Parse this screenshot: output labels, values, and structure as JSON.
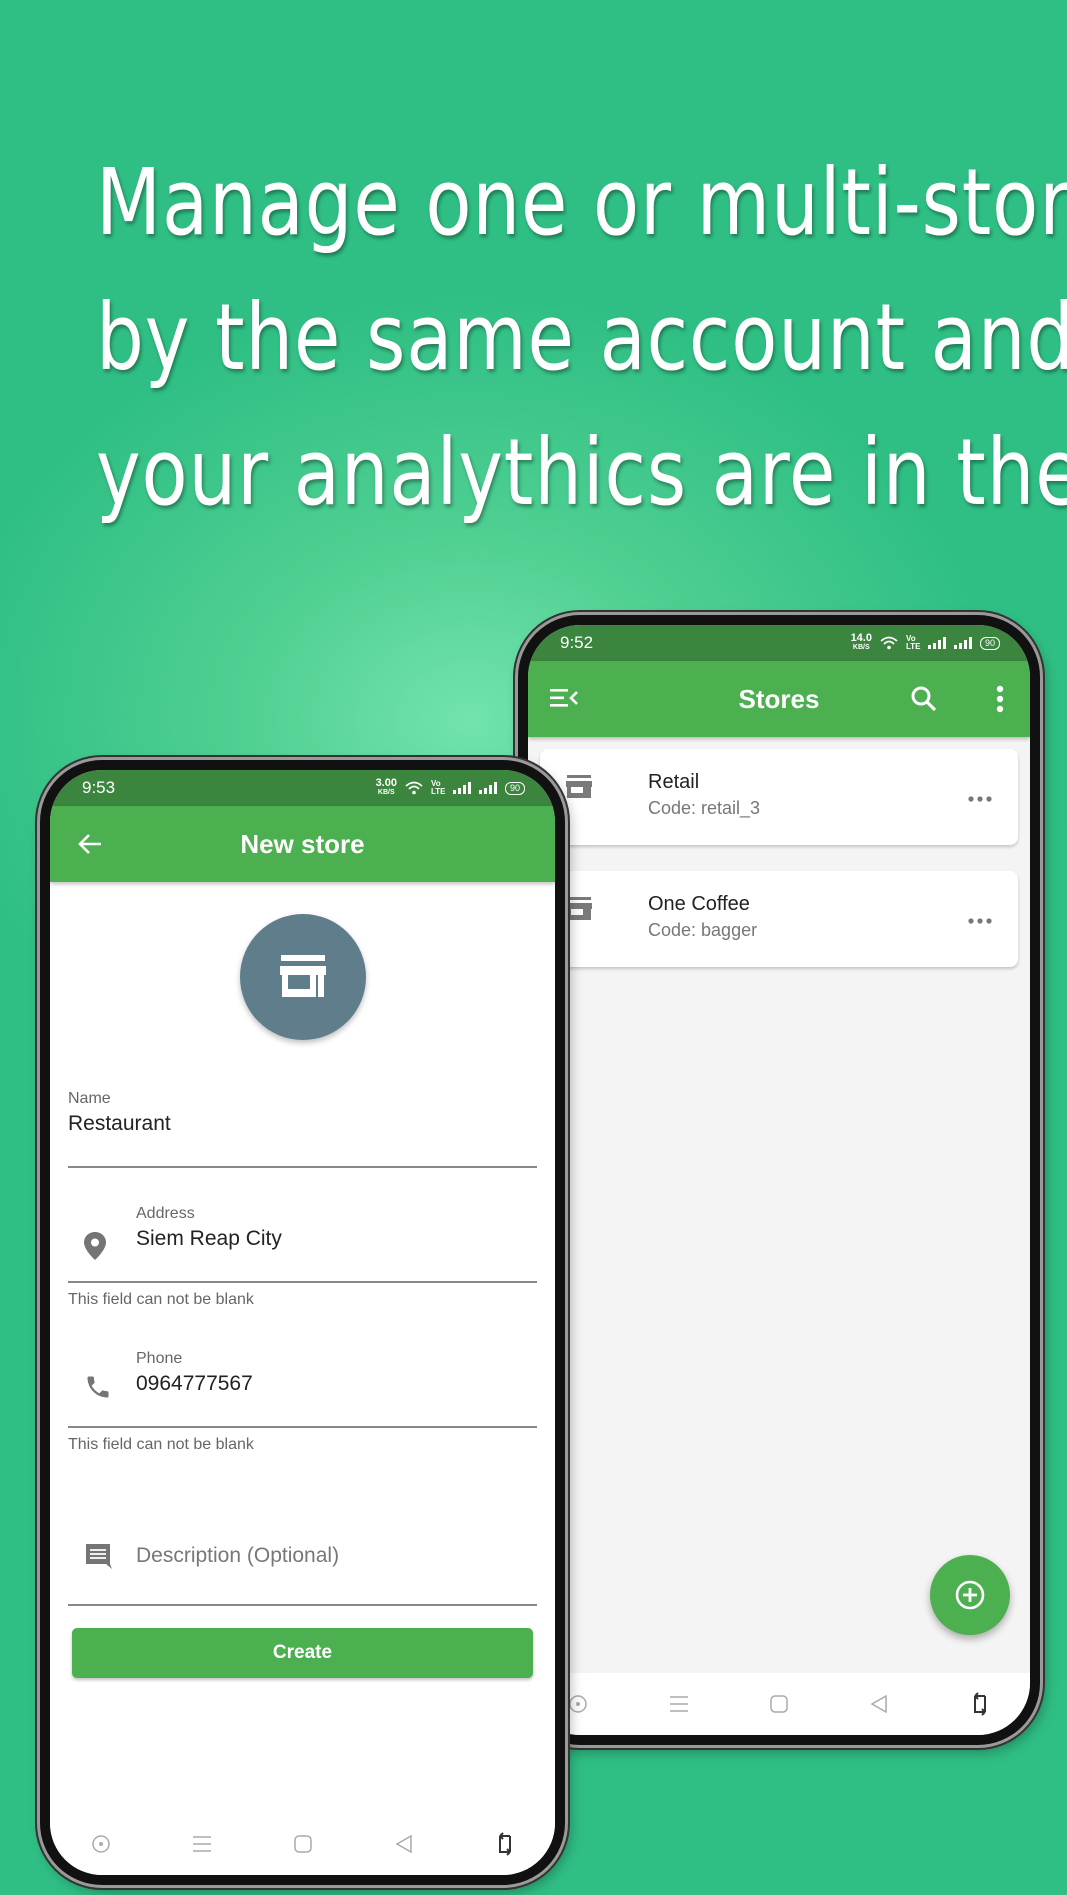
{
  "headline": {
    "lines": [
      "Manage one or multi-stores",
      "by the same account and",
      "your analythics are in the cloud"
    ]
  },
  "colors": {
    "primary": "#4caf50",
    "status_bar": "#3b853e",
    "avatar": "#607d8b",
    "background": "#2fbf84"
  },
  "stores_screen": {
    "status": {
      "time": "9:52",
      "speed_value": "14.0",
      "speed_unit": "KB/S",
      "network": "Vo LTE",
      "battery": "90"
    },
    "appbar": {
      "title": "Stores",
      "menu_icon": "menu-collapse-icon",
      "search_icon": "search-icon",
      "more_icon": "more-vert-icon"
    },
    "stores": [
      {
        "name": "Retail",
        "code": "Code: retail_3",
        "icon": "store-icon",
        "menu_icon": "more-horiz-icon"
      },
      {
        "name": "One Coffee",
        "code": "Code: bagger",
        "icon": "store-icon",
        "menu_icon": "more-horiz-icon"
      }
    ],
    "fab_icon": "add-circle-icon",
    "navbar": [
      "screenshot-icon",
      "menu-icon",
      "home-icon",
      "back-icon",
      "rotate-icon"
    ]
  },
  "new_store_screen": {
    "status": {
      "time": "9:53",
      "speed_value": "3.00",
      "speed_unit": "KB/S",
      "network": "Vo LTE",
      "battery": "90"
    },
    "appbar": {
      "title": "New store",
      "back_icon": "arrow-back-icon"
    },
    "avatar_icon": "store-icon",
    "fields": {
      "name": {
        "label": "Name",
        "value": "Restaurant"
      },
      "address": {
        "label": "Address",
        "value": "Siem Reap City",
        "error": "This field can not be blank",
        "icon": "location-pin-icon"
      },
      "phone": {
        "label": "Phone",
        "value": "0964777567",
        "error": "This field can not be blank",
        "icon": "phone-icon"
      },
      "description": {
        "placeholder": "Description (Optional)",
        "value": "",
        "icon": "comment-icon"
      }
    },
    "create_button": "Create",
    "navbar": [
      "screenshot-icon",
      "menu-icon",
      "home-icon",
      "back-icon",
      "rotate-icon"
    ]
  }
}
